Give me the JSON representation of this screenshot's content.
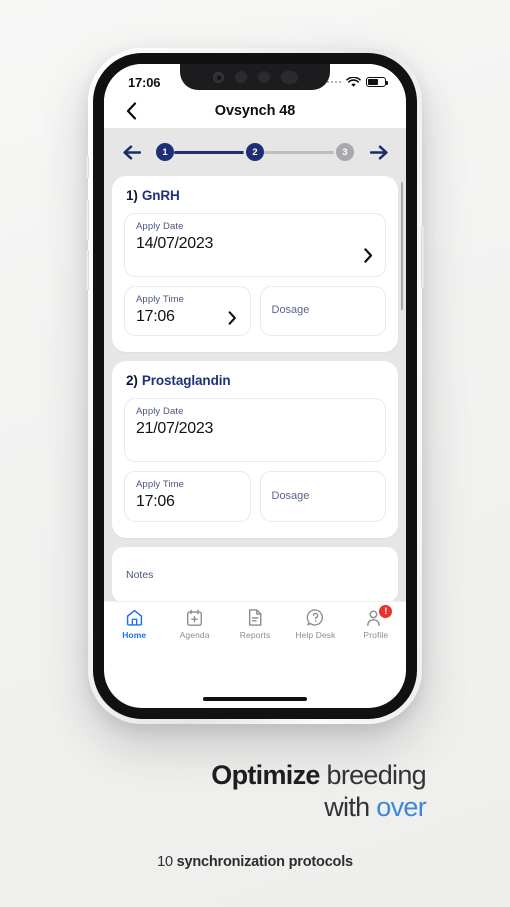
{
  "status_bar": {
    "time": "17:06",
    "signal_icon": "signal-dots-icon",
    "wifi_icon": "wifi-icon",
    "battery_icon": "battery-icon",
    "battery_level_percent": 62
  },
  "nav": {
    "back_icon": "chevron-left-icon",
    "title": "Ovsynch 48"
  },
  "stepper": {
    "prev_icon": "arrow-left-icon",
    "next_icon": "arrow-right-icon",
    "steps": [
      {
        "label": "1",
        "state": "active"
      },
      {
        "label": "2",
        "state": "active"
      },
      {
        "label": "3",
        "state": "inactive"
      }
    ]
  },
  "cards": [
    {
      "number": "1)",
      "name": "GnRH",
      "date_field": {
        "label": "Apply Date",
        "value": "14/07/2023",
        "chevron": "chevron-right-icon"
      },
      "time_field": {
        "label": "Apply Time",
        "value": "17:06",
        "chevron": "chevron-right-icon"
      },
      "dosage_field": {
        "placeholder": "Dosage",
        "value": ""
      }
    },
    {
      "number": "2)",
      "name": "Prostaglandin",
      "date_field": {
        "label": "Apply Date",
        "value": "21/07/2023",
        "chevron": ""
      },
      "time_field": {
        "label": "Apply Time",
        "value": "17:06",
        "chevron": ""
      },
      "dosage_field": {
        "placeholder": "Dosage",
        "value": ""
      }
    }
  ],
  "notes": {
    "label": "Notes",
    "value": ""
  },
  "tabbar": {
    "items": [
      {
        "label": "Home",
        "icon": "home-icon",
        "active": true,
        "badge": ""
      },
      {
        "label": "Agenda",
        "icon": "calendar-plus-icon",
        "active": false,
        "badge": ""
      },
      {
        "label": "Reports",
        "icon": "document-icon",
        "active": false,
        "badge": ""
      },
      {
        "label": "Help Desk",
        "icon": "question-bubble-icon",
        "active": false,
        "badge": ""
      },
      {
        "label": "Profile",
        "icon": "person-icon",
        "active": false,
        "badge": "!"
      }
    ]
  },
  "tagline": {
    "line1_bold": "Optimize",
    "line1_rest": " breeding",
    "line2_plain": "with ",
    "line2_accent": "over",
    "sub_prefix": "10 ",
    "sub_bold": "synchronization protocols"
  },
  "colors": {
    "brand_navy": "#1f2f77",
    "brand_blue": "#20317a",
    "accent_blue": "#3d87d6",
    "tab_active": "#1a73e8",
    "badge_red": "#e8342a",
    "step_inactive": "#a9a9ad",
    "screen_bg": "#e6e6e6"
  }
}
